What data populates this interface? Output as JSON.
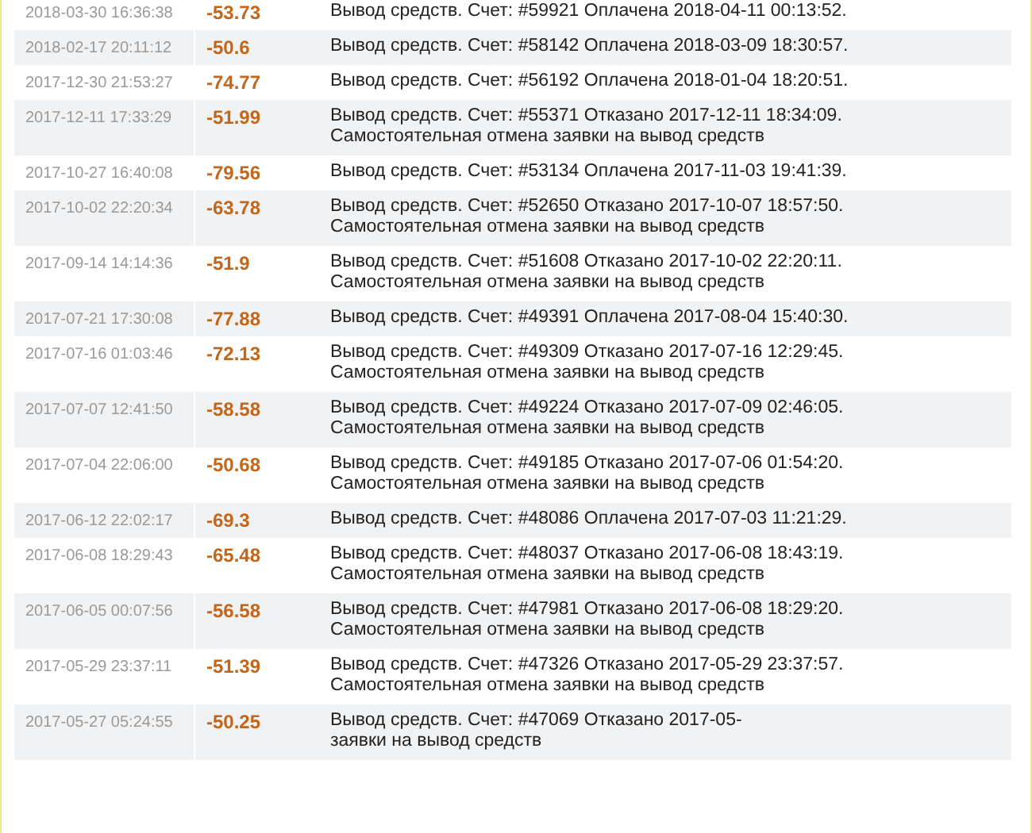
{
  "rows": [
    {
      "date": "2018-03-30 16:36:38",
      "amount": "-53.73",
      "text": "Вывод средств. Счет: #59921 Оплачена 2018-04-11 00:13:52."
    },
    {
      "date": "2018-02-17 20:11:12",
      "amount": "-50.6",
      "text": "Вывод средств. Счет: #58142 Оплачена 2018-03-09 18:30:57."
    },
    {
      "date": "2017-12-30 21:53:27",
      "amount": "-74.77",
      "text": "Вывод средств. Счет: #56192 Оплачена 2018-01-04 18:20:51."
    },
    {
      "date": "2017-12-11 17:33:29",
      "amount": "-51.99",
      "text": "Вывод средств. Счет: #55371 Отказано 2017-12-11 18:34:09. Самостоятельная отмена заявки на вывод средств"
    },
    {
      "date": "2017-10-27 16:40:08",
      "amount": "-79.56",
      "text": "Вывод средств. Счет: #53134 Оплачена 2017-11-03 19:41:39."
    },
    {
      "date": "2017-10-02 22:20:34",
      "amount": "-63.78",
      "text": "Вывод средств. Счет: #52650 Отказано 2017-10-07 18:57:50. Самостоятельная отмена заявки на вывод средств"
    },
    {
      "date": "2017-09-14 14:14:36",
      "amount": "-51.9",
      "text": "Вывод средств. Счет: #51608 Отказано 2017-10-02 22:20:11. Самостоятельная отмена заявки на вывод средств"
    },
    {
      "date": "2017-07-21 17:30:08",
      "amount": "-77.88",
      "text": "Вывод средств. Счет: #49391 Оплачена 2017-08-04 15:40:30."
    },
    {
      "date": "2017-07-16 01:03:46",
      "amount": "-72.13",
      "text": "Вывод средств. Счет: #49309 Отказано 2017-07-16 12:29:45. Самостоятельная отмена заявки на вывод средств"
    },
    {
      "date": "2017-07-07 12:41:50",
      "amount": "-58.58",
      "text": "Вывод средств. Счет: #49224 Отказано 2017-07-09 02:46:05. Самостоятельная отмена заявки на вывод средств"
    },
    {
      "date": "2017-07-04 22:06:00",
      "amount": "-50.68",
      "text": "Вывод средств. Счет: #49185 Отказано 2017-07-06 01:54:20. Самостоятельная отмена заявки на вывод средств"
    },
    {
      "date": "2017-06-12 22:02:17",
      "amount": "-69.3",
      "text": "Вывод средств. Счет: #48086 Оплачена 2017-07-03 11:21:29."
    },
    {
      "date": "2017-06-08 18:29:43",
      "amount": "-65.48",
      "text": "Вывод средств. Счет: #48037 Отказано 2017-06-08 18:43:19. Самостоятельная отмена заявки на вывод средств"
    },
    {
      "date": "2017-06-05 00:07:56",
      "amount": "-56.58",
      "text": "Вывод средств. Счет: #47981 Отказано 2017-06-08 18:29:20. Самостоятельная отмена заявки на вывод средств"
    },
    {
      "date": "2017-05-29 23:37:11",
      "amount": "-51.39",
      "text": "Вывод средств. Счет: #47326 Отказано 2017-05-29 23:37:57. Самостоятельная отмена заявки на вывод средств"
    },
    {
      "date": "2017-05-27 05:24:55",
      "amount": "-50.25",
      "text": "Вывод средств. Счет: #47069 Отказано 2017-05-",
      "text_2": "заявки на вывод средств"
    }
  ]
}
